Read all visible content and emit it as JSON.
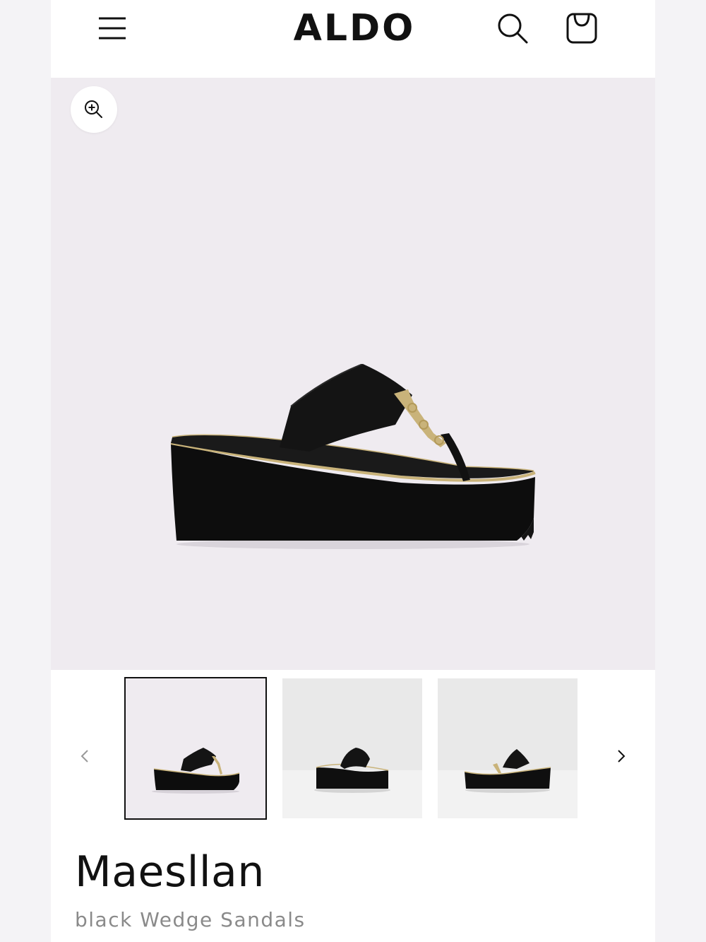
{
  "header": {
    "brand": "ALDO",
    "icons": [
      "menu-icon",
      "search-icon",
      "shopping-bag-icon"
    ]
  },
  "gallery": {
    "zoom_icon": "zoom-in-icon",
    "prev_icon": "chevron-left-icon",
    "next_icon": "chevron-right-icon",
    "selected_thumbnail": 1,
    "thumbnail_count_visible": 3
  },
  "product": {
    "name": "Maesllan",
    "subtitle": "black Wedge Sandals"
  },
  "colors": {
    "hero_background": "#efebf0",
    "thumb_background": "#e9e9e9",
    "text_primary": "#111111",
    "text_secondary": "#8a8a8a",
    "gold_trim": "#c9b37a"
  }
}
